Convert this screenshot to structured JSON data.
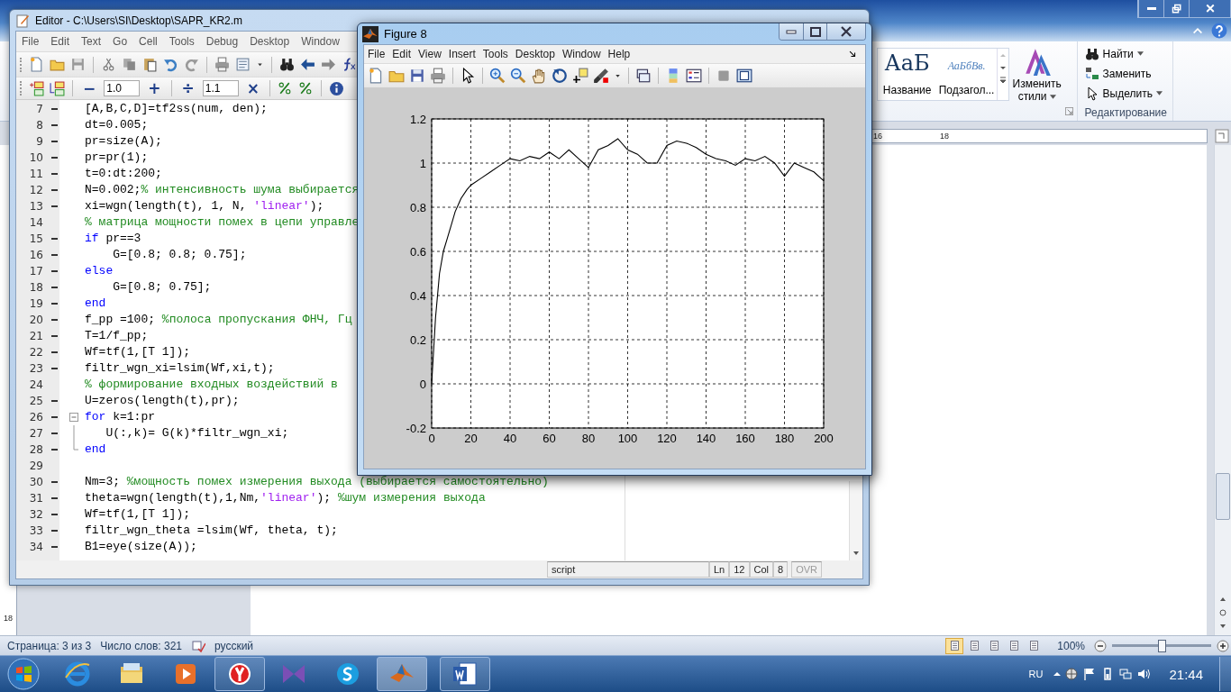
{
  "word": {
    "styles": [
      {
        "kind": "title",
        "sample": "АаБ",
        "label": "Название"
      },
      {
        "kind": "subtitle",
        "sample": "АаБбВв.",
        "label": "Подзагол..."
      }
    ],
    "change_styles": "Изменить стили",
    "editing": {
      "items": [
        {
          "label": "Найти",
          "kind": "find",
          "dropdown": true
        },
        {
          "label": "Заменить",
          "kind": "replace",
          "dropdown": false
        },
        {
          "label": "Выделить",
          "kind": "select",
          "dropdown": true
        }
      ],
      "group_label": "Редактирование"
    },
    "ruler": [
      "16",
      "18"
    ],
    "vruler": "18",
    "status_bar": {
      "page": "Страница: 3 из 3",
      "words": "Число слов: 321",
      "language": "русский",
      "views": [
        {
          "selected": true
        },
        {
          "selected": false
        },
        {
          "selected": false
        },
        {
          "selected": false
        },
        {
          "selected": false
        }
      ],
      "zoom": "100%",
      "zoom_slider": {
        "level": 0.5
      }
    }
  },
  "editor": {
    "title": "Editor - C:\\Users\\SI\\Desktop\\SAPR_KR2.m",
    "menu": [
      "File",
      "Edit",
      "Text",
      "Go",
      "Cell",
      "Tools",
      "Debug",
      "Desktop",
      "Window"
    ],
    "cell_toolbar": {
      "decrement": "−",
      "value_1": "1.0",
      "increment": "+",
      "divide": "÷",
      "value_2": "1.1",
      "multiply": "×"
    },
    "lines": [
      {
        "num": "7",
        "kind": "line",
        "breakpoint": true,
        "segments": [
          {
            "kind": "code",
            "text": "[A,B,C,D]=tf2ss(num, den);"
          }
        ]
      },
      {
        "num": "8",
        "kind": "line",
        "breakpoint": true,
        "segments": [
          {
            "kind": "code",
            "text": "dt=0.005;"
          }
        ]
      },
      {
        "num": "9",
        "kind": "line",
        "breakpoint": true,
        "segments": [
          {
            "kind": "code",
            "text": "pr=size(A);"
          }
        ]
      },
      {
        "num": "10",
        "kind": "line",
        "breakpoint": true,
        "segments": [
          {
            "kind": "code",
            "text": "pr=pr(1);"
          }
        ]
      },
      {
        "num": "11",
        "kind": "line",
        "breakpoint": true,
        "segments": [
          {
            "kind": "code",
            "text": "t=0:dt:200;"
          }
        ]
      },
      {
        "num": "12",
        "kind": "line",
        "breakpoint": true,
        "segments": [
          {
            "kind": "code",
            "text": "N=0.002;"
          },
          {
            "kind": "comment",
            "text": "% интенсивность шума выбирается"
          }
        ]
      },
      {
        "num": "13",
        "kind": "line",
        "breakpoint": true,
        "segments": [
          {
            "kind": "code",
            "text": "xi=wgn(length(t), 1, N, "
          },
          {
            "kind": "string",
            "text": "'linear'"
          },
          {
            "kind": "code",
            "text": ");"
          }
        ]
      },
      {
        "num": "14",
        "kind": "line",
        "breakpoint": false,
        "segments": [
          {
            "kind": "comment",
            "text": "% матрица мощности помех в цепи управле"
          }
        ]
      },
      {
        "num": "15",
        "kind": "line",
        "breakpoint": true,
        "segments": [
          {
            "kind": "keyword",
            "text": "if"
          },
          {
            "kind": "code",
            "text": " pr==3"
          }
        ]
      },
      {
        "num": "16",
        "kind": "line",
        "breakpoint": true,
        "segments": [
          {
            "kind": "code",
            "text": "    G=[0.8; 0.8; 0.75];"
          }
        ]
      },
      {
        "num": "17",
        "kind": "line",
        "breakpoint": true,
        "segments": [
          {
            "kind": "keyword",
            "text": "else"
          }
        ]
      },
      {
        "num": "18",
        "kind": "line",
        "breakpoint": true,
        "segments": [
          {
            "kind": "code",
            "text": "    G=[0.8; 0.75];"
          }
        ]
      },
      {
        "num": "19",
        "kind": "line",
        "breakpoint": true,
        "segments": [
          {
            "kind": "keyword",
            "text": "end"
          }
        ]
      },
      {
        "num": "20",
        "kind": "line",
        "breakpoint": true,
        "segments": [
          {
            "kind": "code",
            "text": "f_pp =100; "
          },
          {
            "kind": "comment",
            "text": "%полоса пропускания ФНЧ, Гц"
          }
        ]
      },
      {
        "num": "21",
        "kind": "line",
        "breakpoint": true,
        "segments": [
          {
            "kind": "code",
            "text": "T=1/f_pp;"
          }
        ]
      },
      {
        "num": "22",
        "kind": "line",
        "breakpoint": true,
        "segments": [
          {
            "kind": "code",
            "text": "Wf=tf(1,[T 1]);"
          }
        ]
      },
      {
        "num": "23",
        "kind": "line",
        "breakpoint": true,
        "segments": [
          {
            "kind": "code",
            "text": "filtr_wgn_xi=lsim(Wf,xi,t);"
          }
        ]
      },
      {
        "num": "24",
        "kind": "line",
        "breakpoint": false,
        "segments": [
          {
            "kind": "comment",
            "text": "% формирование входных воздействий в"
          }
        ]
      },
      {
        "num": "25",
        "kind": "line",
        "breakpoint": true,
        "segments": [
          {
            "kind": "code",
            "text": "U=zeros(length(t),pr);"
          }
        ]
      },
      {
        "num": "26",
        "kind": "fold_start",
        "breakpoint": true,
        "segments": [
          {
            "kind": "keyword",
            "text": "for"
          },
          {
            "kind": "code",
            "text": " k=1:pr"
          }
        ]
      },
      {
        "num": "27",
        "kind": "fold_body",
        "breakpoint": true,
        "segments": [
          {
            "kind": "code",
            "text": "   U(:,k)= G(k)*filtr_wgn_xi;"
          }
        ]
      },
      {
        "num": "28",
        "kind": "fold_end",
        "breakpoint": true,
        "segments": [
          {
            "kind": "keyword",
            "text": "end"
          }
        ]
      },
      {
        "num": "29",
        "kind": "line",
        "breakpoint": false
      },
      {
        "num": "30",
        "kind": "line",
        "breakpoint": true,
        "segments": [
          {
            "kind": "code",
            "text": "Nm=3; "
          },
          {
            "kind": "comment",
            "text": "%мощность помех измерения выхода (выбирается самостоятельно)"
          }
        ]
      },
      {
        "num": "31",
        "kind": "line",
        "breakpoint": true,
        "segments": [
          {
            "kind": "code",
            "text": "theta=wgn(length(t),1,Nm,"
          },
          {
            "kind": "string",
            "text": "'linear'"
          },
          {
            "kind": "code",
            "text": "); "
          },
          {
            "kind": "comment",
            "text": "%шум измерения выхода"
          }
        ]
      },
      {
        "num": "32",
        "kind": "line",
        "breakpoint": true,
        "segments": [
          {
            "kind": "code",
            "text": "Wf=tf(1,[T 1]);"
          }
        ]
      },
      {
        "num": "33",
        "kind": "line",
        "breakpoint": true,
        "segments": [
          {
            "kind": "code",
            "text": "filtr_wgn_theta =lsim(Wf, theta, t);"
          }
        ]
      },
      {
        "num": "34",
        "kind": "line",
        "breakpoint": true,
        "segments": [
          {
            "kind": "code",
            "text": "B1=eye(size(A));"
          }
        ]
      }
    ],
    "status": {
      "mode": "script",
      "ln_label": "Ln",
      "ln": "12",
      "col_label": "Col",
      "col": "8",
      "ovr": "OVR",
      "ovr_disabled": true
    }
  },
  "figure": {
    "title": "Figure 8",
    "menu": [
      "File",
      "Edit",
      "View",
      "Insert",
      "Tools",
      "Desktop",
      "Window",
      "Help"
    ],
    "chart_data": {
      "type": "line",
      "grid": true,
      "xlim": [
        0,
        200
      ],
      "ylim": [
        -0.2,
        1.2
      ],
      "xticks": [
        0,
        20,
        40,
        60,
        80,
        100,
        120,
        140,
        160,
        180,
        200
      ],
      "yticks": [
        -0.2,
        0,
        0.2,
        0.4,
        0.6,
        0.8,
        1,
        1.2
      ],
      "x": [
        0,
        2,
        4,
        6,
        8,
        10,
        12,
        15,
        18,
        20,
        25,
        30,
        35,
        40,
        45,
        50,
        55,
        60,
        65,
        70,
        75,
        80,
        85,
        90,
        95,
        100,
        105,
        110,
        115,
        120,
        125,
        130,
        135,
        140,
        145,
        150,
        155,
        160,
        165,
        170,
        175,
        180,
        185,
        190,
        195,
        200
      ],
      "series": [
        {
          "color": "#000000",
          "values": [
            0,
            0.3,
            0.5,
            0.6,
            0.66,
            0.72,
            0.78,
            0.84,
            0.88,
            0.9,
            0.93,
            0.96,
            0.99,
            1.02,
            1.01,
            1.03,
            1.02,
            1.05,
            1.02,
            1.06,
            1.02,
            0.98,
            1.06,
            1.08,
            1.11,
            1.06,
            1.04,
            1.0,
            1.0,
            1.08,
            1.1,
            1.09,
            1.07,
            1.04,
            1.02,
            1.01,
            0.99,
            1.02,
            1.01,
            1.03,
            1.0,
            0.94,
            1.0,
            0.98,
            0.96,
            0.92
          ]
        }
      ]
    }
  },
  "taskbar": {
    "apps": [
      {
        "kind": "browser",
        "running": false,
        "selected": false
      },
      {
        "kind": "files",
        "running": false,
        "selected": false
      },
      {
        "kind": "media",
        "running": false,
        "selected": false
      },
      {
        "kind": "yandex",
        "running": true,
        "selected": false
      },
      {
        "kind": "studio",
        "running": false,
        "selected": false
      },
      {
        "kind": "skype",
        "running": false,
        "selected": false
      },
      {
        "kind": "matlab",
        "running": true,
        "selected": true
      },
      {
        "kind": "word",
        "running": true,
        "selected": false
      }
    ],
    "language": "RU",
    "clock": "21:44"
  }
}
